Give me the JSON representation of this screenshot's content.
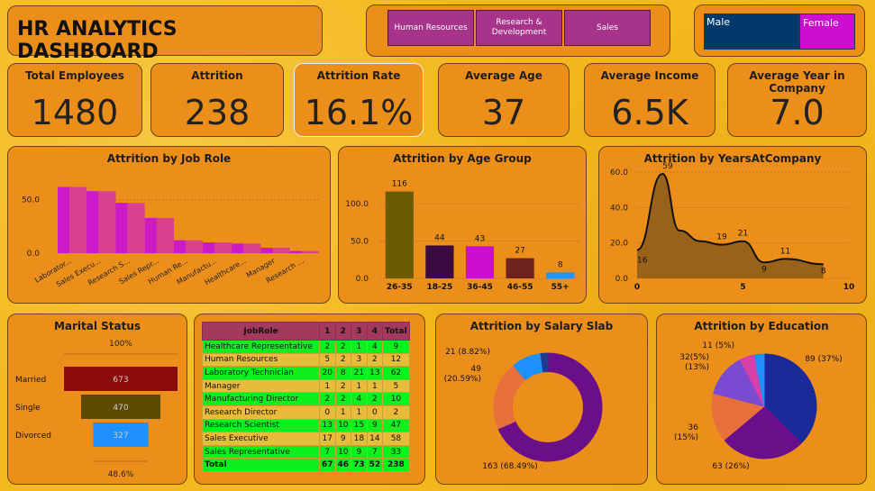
{
  "header": {
    "title": "HR ANALYTICS DASHBOARD"
  },
  "department_slicer": {
    "items": [
      "Human Resources",
      "Research & Development",
      "Sales"
    ]
  },
  "gender_slicer": {
    "items": [
      "Male",
      "Female"
    ]
  },
  "kpis": [
    {
      "title": "Total Employees",
      "value": "1480"
    },
    {
      "title": "Attrition",
      "value": "238"
    },
    {
      "title": "Attrition Rate",
      "value": "16.1%"
    },
    {
      "title": "Average Age",
      "value": "37"
    },
    {
      "title": "Average Income",
      "value": "6.5K"
    },
    {
      "title": "Average Year in Company",
      "value": "7.0"
    }
  ],
  "colors": {
    "background": "#F4B91E",
    "card": "#EC8F1A",
    "magenta": "#CC1AC9",
    "pink": "#D9418F",
    "male": "#003A6B"
  },
  "chart_data": [
    {
      "id": "job_role",
      "type": "area",
      "title": "Attrition by Job Role",
      "categories": [
        "Laborator...",
        "Sales Execu...",
        "Research S...",
        "Sales Repr...",
        "Human Re...",
        "Manufactu...",
        "Healthcare...",
        "Manager",
        "Research ..."
      ],
      "values": [
        62,
        58,
        47,
        33,
        12,
        10,
        9,
        5,
        2
      ],
      "ylim": [
        0,
        70
      ],
      "yticks": [
        "0.0",
        "50.0"
      ],
      "grid": true
    },
    {
      "id": "age_group",
      "type": "bar",
      "title": "Attrition by Age Group",
      "categories": [
        "26-35",
        "18-25",
        "36-45",
        "46-55",
        "55+"
      ],
      "values": [
        116,
        44,
        43,
        27,
        8
      ],
      "colors": [
        "#6B5A00",
        "#3A0A40",
        "#CC0ED0",
        "#6E2220",
        "#2196F3"
      ],
      "ylim": [
        0,
        130
      ],
      "yticks": [
        "0.0",
        "50.0",
        "100.0"
      ],
      "grid": true
    },
    {
      "id": "years_at_company",
      "type": "area",
      "title": "Attrition by YearsAtCompany",
      "x": [
        0,
        1,
        2,
        3,
        4,
        5,
        6,
        7,
        8,
        9,
        10
      ],
      "values": [
        16,
        59,
        27,
        21,
        19,
        21,
        9,
        11,
        8
      ],
      "labels": [
        "16",
        "59",
        "19",
        "21",
        "9",
        "11",
        "8"
      ],
      "xlim": [
        0,
        10
      ],
      "ylim": [
        0,
        60
      ],
      "xticks": [
        "0",
        "5",
        "10"
      ],
      "yticks": [
        "0.0",
        "20.0",
        "40.0",
        "60.0"
      ],
      "grid": true
    },
    {
      "id": "marital_status",
      "type": "bar",
      "title": "Marital Status",
      "categories": [
        "Married",
        "Single",
        "Divorced"
      ],
      "values": [
        673,
        470,
        327
      ],
      "colors": [
        "#8B0A0A",
        "#5C4A00",
        "#1E90FF"
      ],
      "top_label": "100%",
      "bottom_label": "48.6%"
    },
    {
      "id": "job_role_table",
      "type": "table",
      "columns": [
        "JobRole",
        "1",
        "2",
        "3",
        "4",
        "Total"
      ],
      "rows": [
        [
          "Healthcare Representative",
          "2",
          "2",
          "1",
          "4",
          "9"
        ],
        [
          "Human Resources",
          "5",
          "2",
          "3",
          "2",
          "12"
        ],
        [
          "Laboratory Technician",
          "20",
          "8",
          "21",
          "13",
          "62"
        ],
        [
          "Manager",
          "1",
          "2",
          "1",
          "1",
          "5"
        ],
        [
          "Manufacturing Director",
          "2",
          "2",
          "4",
          "2",
          "10"
        ],
        [
          "Research Director",
          "0",
          "1",
          "1",
          "0",
          "2"
        ],
        [
          "Research Scientist",
          "13",
          "10",
          "15",
          "9",
          "47"
        ],
        [
          "Sales Executive",
          "17",
          "9",
          "18",
          "14",
          "58"
        ],
        [
          "Sales Representative",
          "7",
          "10",
          "9",
          "7",
          "33"
        ]
      ],
      "total": [
        "Total",
        "67",
        "46",
        "73",
        "52",
        "238"
      ]
    },
    {
      "id": "salary_slab",
      "type": "pie",
      "title": "Attrition by Salary Slab",
      "values": [
        163,
        49,
        21,
        5
      ],
      "labels": [
        "163 (68.49%)",
        "49 (20.59%)",
        "21 (8.82%)",
        ""
      ],
      "colors": [
        "#6A0E8A",
        "#E8703A",
        "#1E90FF",
        "#1E3A8A"
      ]
    },
    {
      "id": "education",
      "type": "pie",
      "title": "Attrition by Education",
      "values": [
        89,
        63,
        36,
        32,
        11,
        7
      ],
      "labels": [
        "89 (37%)",
        "63 (26%)",
        "36 (15%)",
        "32 (13%)",
        "11 (5%)",
        ""
      ],
      "colors": [
        "#1B2A99",
        "#6A0E8A",
        "#E8703A",
        "#7A4AD0",
        "#D63EA8",
        "#1E90FF"
      ]
    }
  ]
}
